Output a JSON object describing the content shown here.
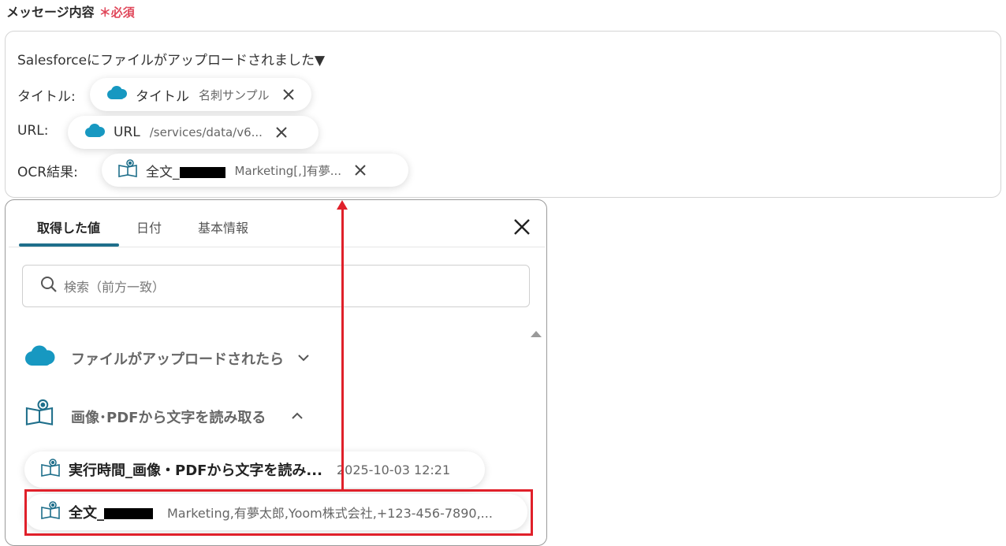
{
  "field": {
    "label": "メッセージ内容",
    "required_mark": "＊必須"
  },
  "message": {
    "line1": "Salesforceにファイルがアップロードされました▼",
    "rows": [
      {
        "label": "タイトル:",
        "chip_name": "タイトル",
        "chip_value": "名刺サンプル"
      },
      {
        "label": "URL:",
        "chip_name": "URL",
        "chip_value": "/services/data/v6..."
      },
      {
        "label": "OCR結果:",
        "chip_name": "全文_",
        "chip_value": "Marketing[,]有夢..."
      }
    ]
  },
  "panel": {
    "tabs": [
      "取得した値",
      "日付",
      "基本情報"
    ],
    "active_tab": 0,
    "search_placeholder": "検索（前方一致）",
    "groups": [
      {
        "title": "ファイルがアップロードされたら",
        "expanded": false,
        "icon": "salesforce-cloud-icon"
      },
      {
        "title": "画像･PDFから文字を読み取る",
        "expanded": true,
        "icon": "ocr-book-icon"
      }
    ],
    "items": [
      {
        "name": "実行時間_画像・PDFから文字を読み...",
        "value": "2025-10-03 12:21"
      },
      {
        "name": "全文_",
        "value": "Marketing,有夢太郎,Yoom株式会社,+123-456-7890,..."
      }
    ]
  },
  "colors": {
    "salesforce": "#1798c1",
    "required": "#e0475a",
    "annotation": "#e0202a",
    "tab_accent": "#1f6f8b"
  }
}
